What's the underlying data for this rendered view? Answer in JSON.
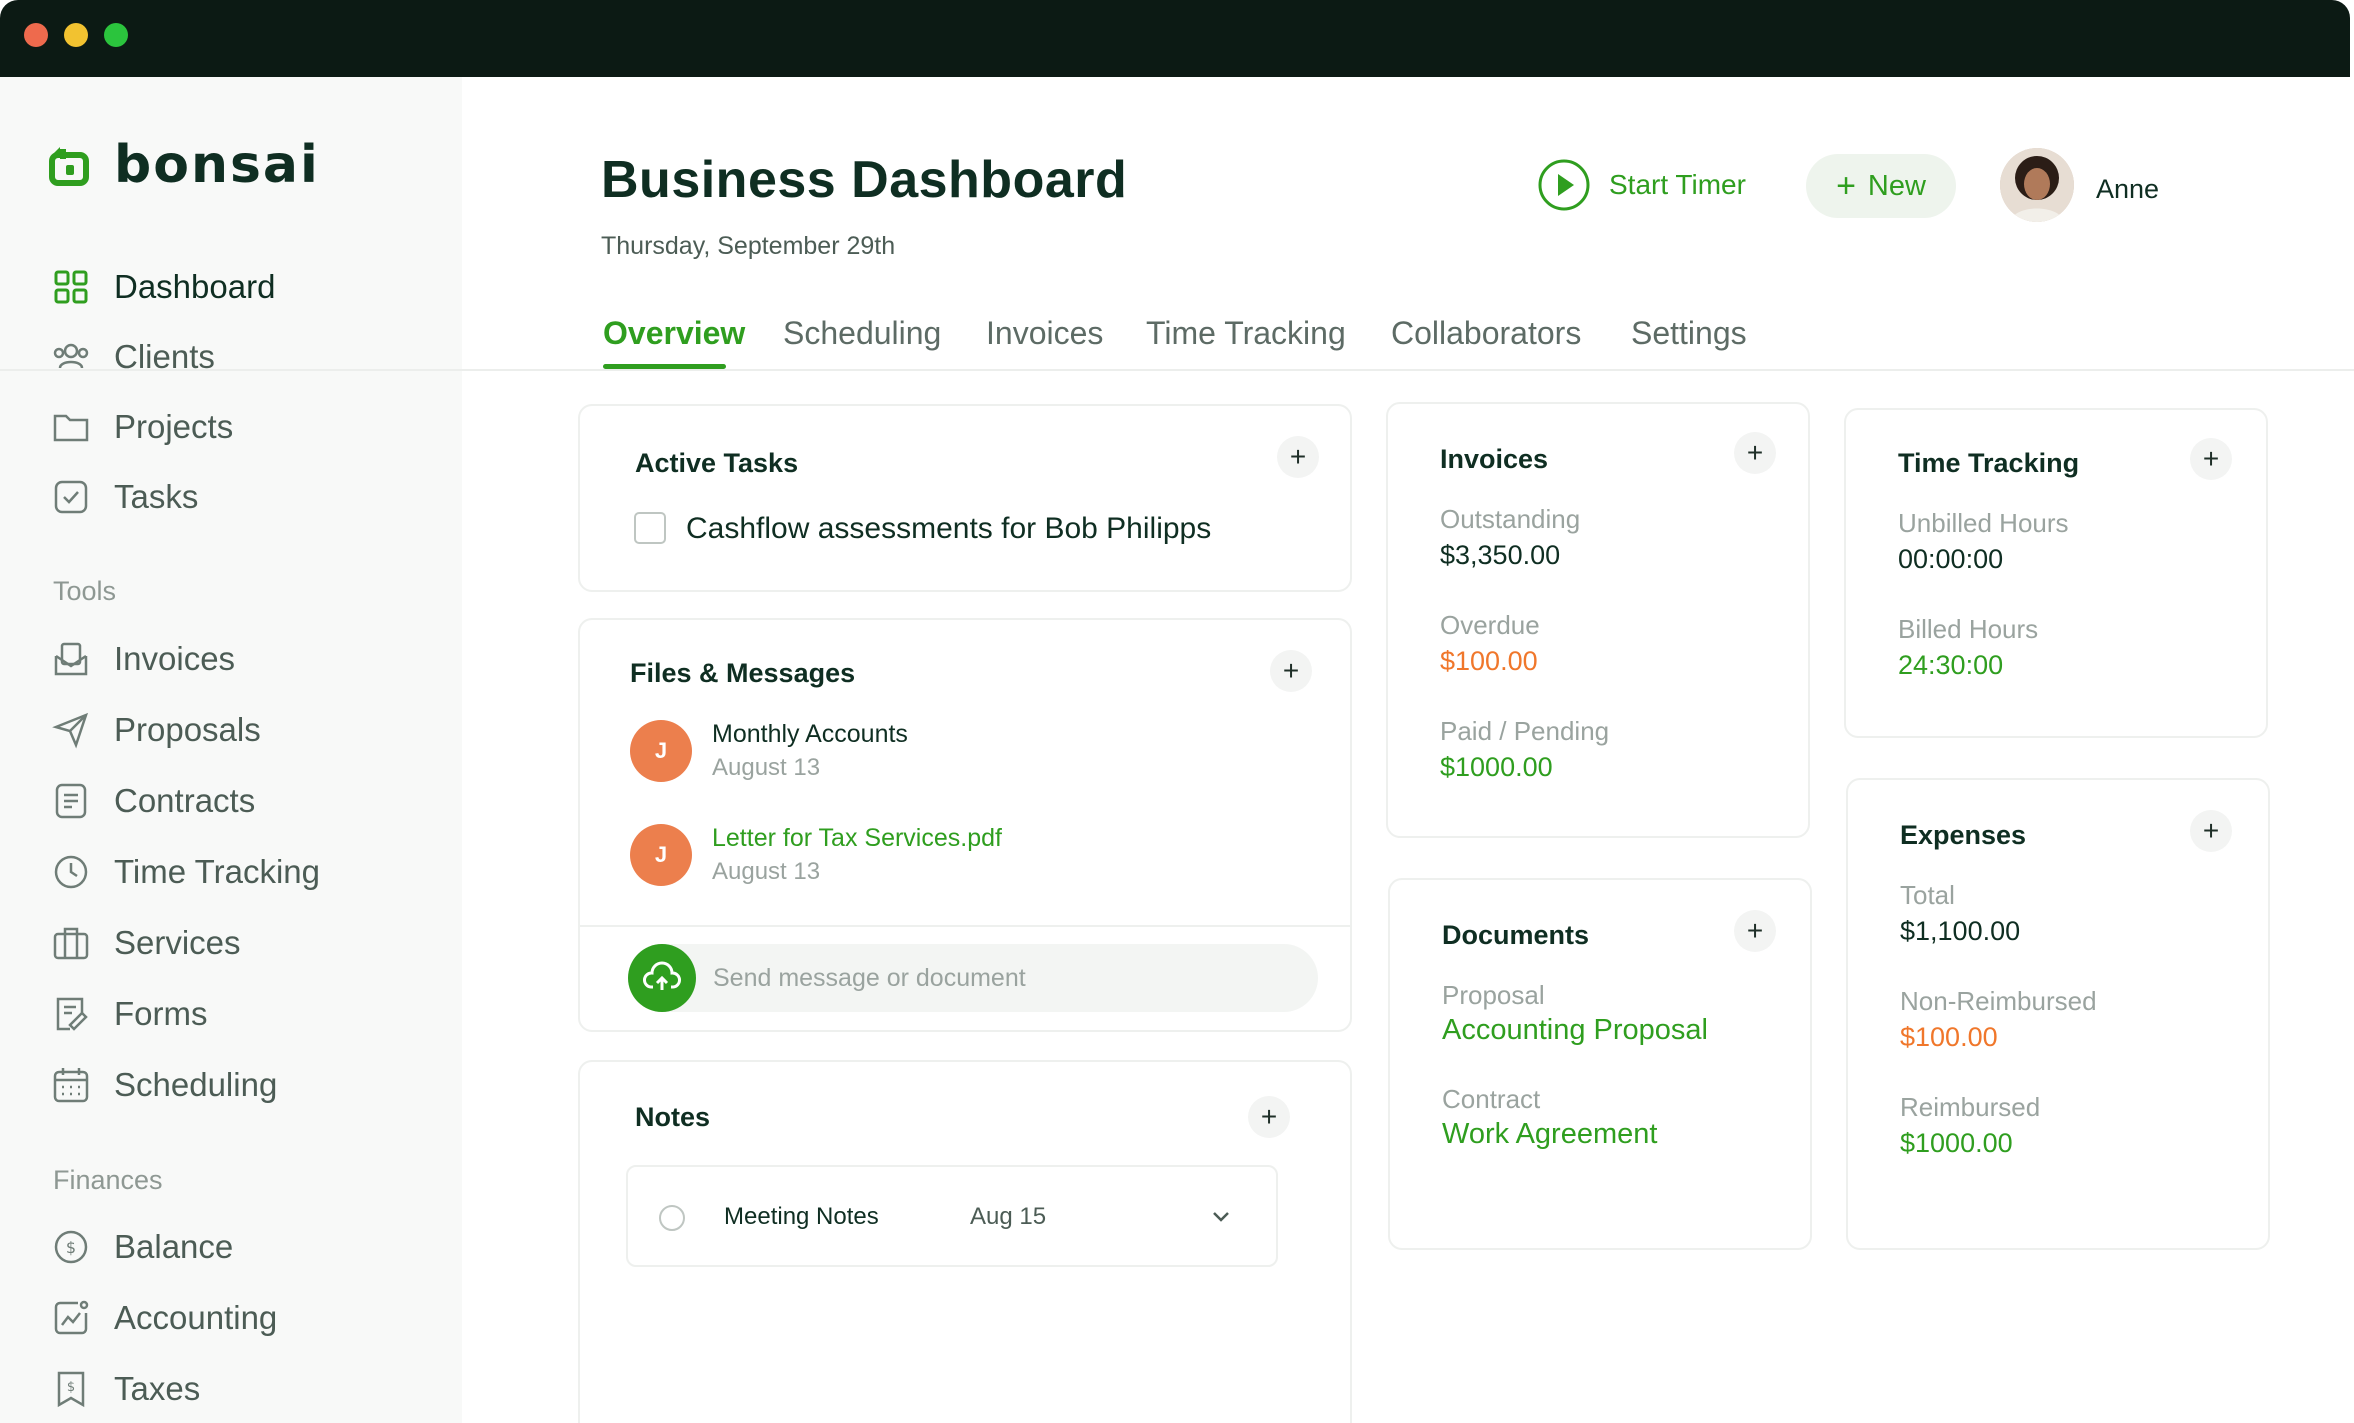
{
  "app": {
    "name": "bonsai"
  },
  "colors": {
    "brand_green": "#2f9e1f",
    "orange": "#f0772b",
    "dark": "#0f2e22"
  },
  "sidebar": {
    "primary": [
      {
        "label": "Dashboard",
        "icon": "grid-icon",
        "active": true
      },
      {
        "label": "Clients",
        "icon": "users-icon"
      },
      {
        "label": "Projects",
        "icon": "folder-icon"
      },
      {
        "label": "Tasks",
        "icon": "checkbox-icon"
      }
    ],
    "tools_label": "Tools",
    "tools": [
      {
        "label": "Invoices",
        "icon": "invoice-icon"
      },
      {
        "label": "Proposals",
        "icon": "send-icon"
      },
      {
        "label": "Contracts",
        "icon": "document-icon"
      },
      {
        "label": "Time Tracking",
        "icon": "clock-icon"
      },
      {
        "label": "Services",
        "icon": "briefcase-icon"
      },
      {
        "label": "Forms",
        "icon": "form-icon"
      },
      {
        "label": "Scheduling",
        "icon": "calendar-icon"
      }
    ],
    "finances_label": "Finances",
    "finances": [
      {
        "label": "Balance",
        "icon": "dollar-icon"
      },
      {
        "label": "Accounting",
        "icon": "chart-icon"
      },
      {
        "label": "Taxes",
        "icon": "tax-icon"
      }
    ]
  },
  "header": {
    "title": "Business Dashboard",
    "date": "Thursday, September 29th",
    "start_timer": "Start Timer",
    "new_label": "New",
    "user_name": "Anne"
  },
  "tabs": [
    "Overview",
    "Scheduling",
    "Invoices",
    "Time Tracking",
    "Collaborators",
    "Settings"
  ],
  "active_tab": "Overview",
  "active_tasks": {
    "title": "Active Tasks",
    "items": [
      {
        "label": "Cashflow assessments for Bob Philipps",
        "done": false
      }
    ]
  },
  "files_messages": {
    "title": "Files & Messages",
    "items": [
      {
        "initial": "J",
        "title": "Monthly Accounts",
        "date": "August 13",
        "is_file": false
      },
      {
        "initial": "J",
        "title": "Letter for Tax Services.pdf",
        "date": "August 13",
        "is_file": true
      }
    ],
    "placeholder": "Send message or document"
  },
  "notes": {
    "title": "Notes",
    "items": [
      {
        "title": "Meeting Notes",
        "date": "Aug 15"
      }
    ]
  },
  "invoices": {
    "title": "Invoices",
    "outstanding_label": "Outstanding",
    "outstanding_value": "$3,350.00",
    "overdue_label": "Overdue",
    "overdue_value": "$100.00",
    "paid_label": "Paid / Pending",
    "paid_value": "$1000.00"
  },
  "documents": {
    "title": "Documents",
    "proposal_label": "Proposal",
    "proposal_value": "Accounting Proposal",
    "contract_label": "Contract",
    "contract_value": "Work Agreement"
  },
  "time_tracking": {
    "title": "Time Tracking",
    "unbilled_label": "Unbilled Hours",
    "unbilled_value": "00:00:00",
    "billed_label": "Billed Hours",
    "billed_value": "24:30:00"
  },
  "expenses": {
    "title": "Expenses",
    "total_label": "Total",
    "total_value": "$1,100.00",
    "nonreimbursed_label": "Non-Reimbursed",
    "nonreimbursed_value": "$100.00",
    "reimbursed_label": "Reimbursed",
    "reimbursed_value": "$1000.00"
  }
}
